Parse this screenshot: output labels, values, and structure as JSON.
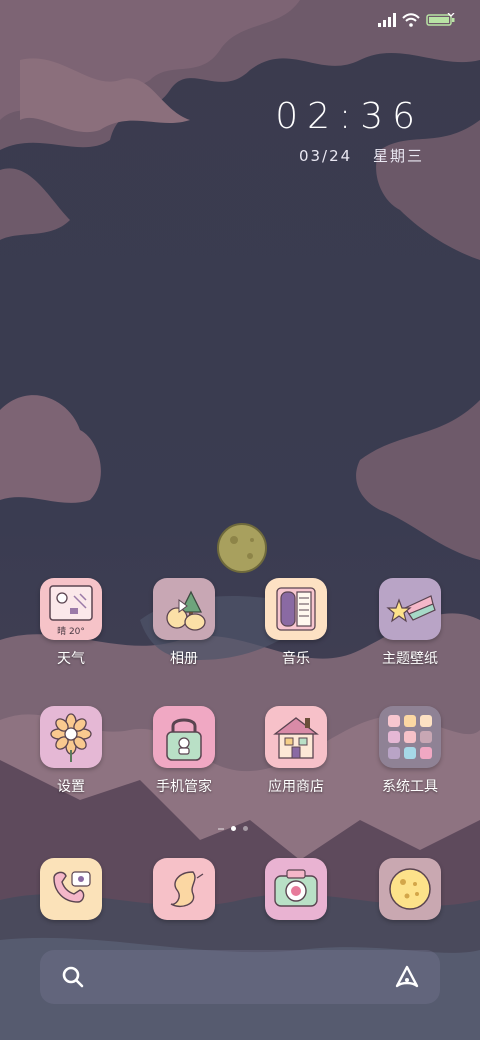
{
  "status_bar": {
    "icons": [
      "signal-icon",
      "wifi-icon",
      "battery-icon"
    ]
  },
  "clock": {
    "time": "02:36",
    "date": "03/24",
    "weekday": "星期三"
  },
  "apps": [
    {
      "name": "weather",
      "label": "天气",
      "badge": "晴 20°",
      "color": "#f6c3c8"
    },
    {
      "name": "gallery",
      "label": "相册",
      "color": "#c8a7b4"
    },
    {
      "name": "music",
      "label": "音乐",
      "color": "#fde1c3"
    },
    {
      "name": "themes",
      "label": "主题壁纸",
      "color": "#b9a4c6"
    },
    {
      "name": "settings",
      "label": "设置",
      "color": "#e5b8d5"
    },
    {
      "name": "phone-manager",
      "label": "手机管家",
      "color": "#f0a8c3"
    },
    {
      "name": "app-store",
      "label": "应用商店",
      "color": "#f7c1c9"
    },
    {
      "name": "system-tools",
      "label": "系统工具",
      "color": "#8f8295"
    }
  ],
  "dock": [
    {
      "name": "phone",
      "color": "#fbe2b9"
    },
    {
      "name": "browser",
      "color": "#f6c1c8"
    },
    {
      "name": "camera",
      "color": "#e9b3d2"
    },
    {
      "name": "moon-app",
      "color": "#c9a8b1"
    }
  ],
  "page_indicator": {
    "pages": 2,
    "current": 1
  },
  "search_bar": {
    "left_icon": "search-icon",
    "right_icon": "assistant-icon"
  }
}
